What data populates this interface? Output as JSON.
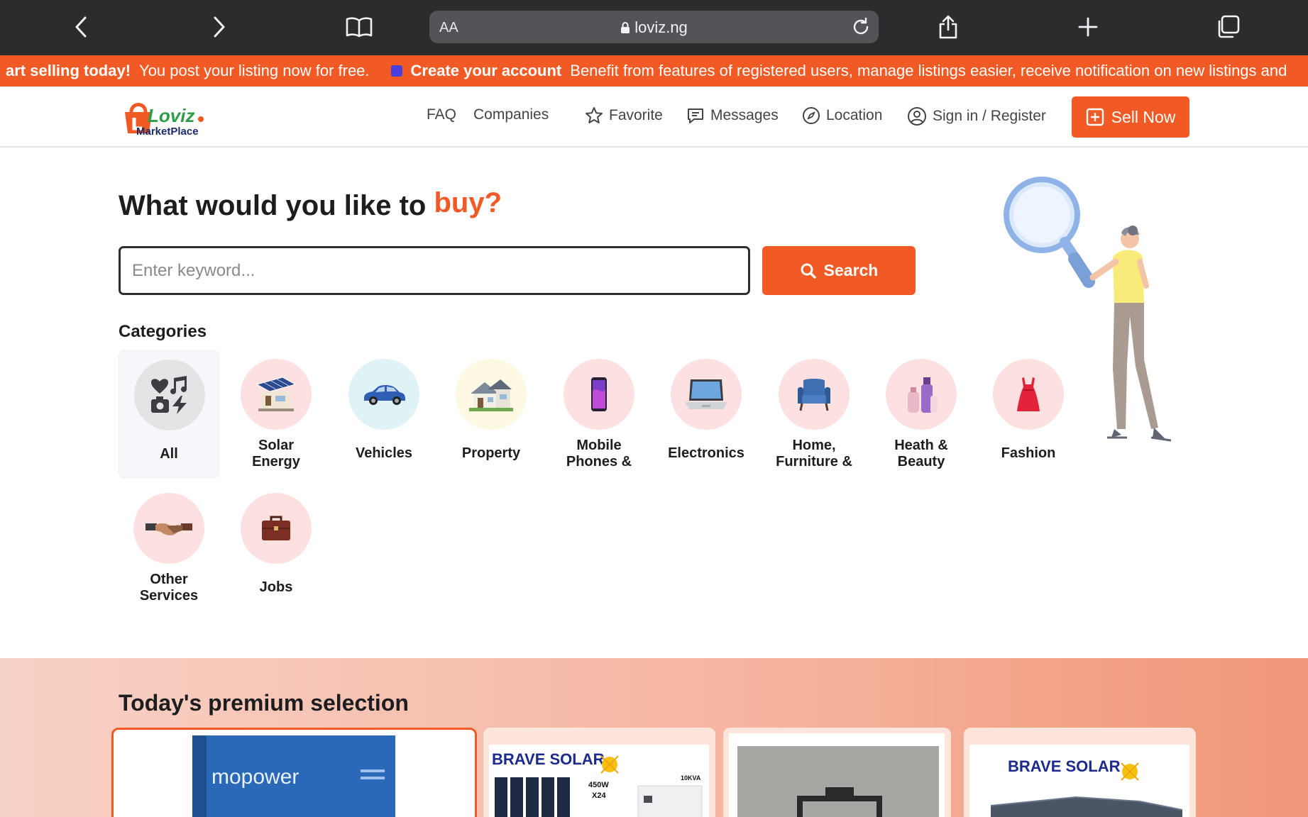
{
  "browser": {
    "text_size": "AA",
    "url": "loviz.ng"
  },
  "promo": {
    "lead_bold": "art selling today!",
    "lead_text": "You post your listing now for free.",
    "cta_bold": "Create your account",
    "cta_text": "Benefit from features of registered users, manage listings easier, receive notification on new listings and"
  },
  "header": {
    "logo_alt": "Loviz MarketPlace",
    "logo_word": "Loviz",
    "logo_sub": "MarketPlace",
    "nav": {
      "faq": "FAQ",
      "companies": "Companies",
      "favorite": "Favorite",
      "messages": "Messages",
      "location": "Location",
      "signin": "Sign in / Register"
    },
    "sell_label": "Sell Now"
  },
  "hero": {
    "title": "What would you like to",
    "title_accent": "buy?",
    "search_placeholder": "Enter keyword...",
    "search_label": "Search"
  },
  "categories": {
    "heading": "Categories",
    "items": [
      {
        "label": "All"
      },
      {
        "label": "Solar\nEnergy"
      },
      {
        "label": "Vehicles"
      },
      {
        "label": "Property"
      },
      {
        "label": "Mobile\nPhones &"
      },
      {
        "label": "Electronics"
      },
      {
        "label": "Home,\nFurniture &"
      },
      {
        "label": "Heath &\nBeauty"
      },
      {
        "label": "Fashion"
      },
      {
        "label": "Other\nServices"
      },
      {
        "label": "Jobs"
      }
    ]
  },
  "premium": {
    "title": "Today's premium selection",
    "cards": [
      {
        "brand": "mopower"
      },
      {
        "brand": "BRAVE SOLAR",
        "spec_a": "450W",
        "spec_b": "X24",
        "spec_c": "10KVA"
      },
      {
        "brand": ""
      },
      {
        "brand": "BRAVE SOLAR"
      }
    ]
  },
  "colors": {
    "accent": "#f15a24",
    "browser_chrome": "#2c2c2e"
  }
}
